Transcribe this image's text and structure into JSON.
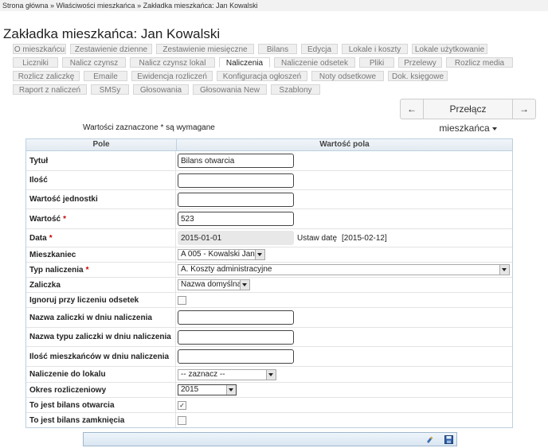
{
  "breadcrumb": "Strona główna » Właściwości mieszkańca » Zakładka mieszkańca: Jan Kowalski",
  "page_title": "Zakładka mieszkańca: Jan Kowalski",
  "tabs": {
    "row1": [
      "O mieszkańcu",
      "Zestawienie dzienne",
      "Zestawienie miesięczne",
      "Bilans",
      "Edycja",
      "Lokale i koszty",
      "Lokale użytkowanie"
    ],
    "row2": [
      "Liczniki",
      "Nalicz czynsz",
      "Nalicz czynsz lokal",
      "Naliczenia",
      "Naliczenie odsetek",
      "Pliki",
      "Przelewy",
      "Rozlicz media"
    ],
    "row3": [
      "Rozlicz zaliczkę",
      "Emaile",
      "Ewidencja rozliczeń",
      "Konfiguracja ogłoszeń",
      "Noty odsetkowe",
      "Dok. księgowe"
    ],
    "row4": [
      "Raport z naliczeń",
      "SMSy",
      "Głosowania",
      "Głosowania New",
      "Szablony"
    ],
    "active": "Naliczenia"
  },
  "nav": {
    "prev": "←",
    "switch": "Przełącz mieszkańca",
    "next": "→"
  },
  "required_note": "Wartości zaznaczone * są wymagane",
  "table": {
    "col_field": "Pole",
    "col_value": "Wartość pola",
    "rows": {
      "tytul": {
        "label": "Tytuł",
        "value": "Bilans otwarcia"
      },
      "ilosc": {
        "label": "Ilość",
        "value": ""
      },
      "wartosc_jedn": {
        "label": "Wartość jednostki",
        "value": ""
      },
      "wartosc": {
        "label": "Wartość",
        "value": "523",
        "required": "*"
      },
      "data": {
        "label": "Data",
        "value": "2015-01-01",
        "required": "*",
        "set_date": "Ustaw datę",
        "date_hint": "[2015-02-12]"
      },
      "mieszkaniec": {
        "label": "Mieszkaniec",
        "value": "A 005 - Kowalski Jan"
      },
      "typ": {
        "label": "Typ naliczenia",
        "value": "A. Koszty administracyjne",
        "required": "*"
      },
      "zaliczka": {
        "label": "Zaliczka",
        "value": "Nazwa domyślna"
      },
      "ignoruj": {
        "label": "Ignoruj przy liczeniu odsetek",
        "checked": false
      },
      "nazwa_zal": {
        "label": "Nazwa zaliczki w dniu naliczenia",
        "value": ""
      },
      "nazwa_typu": {
        "label": "Nazwa typu zaliczki w dniu naliczenia",
        "value": ""
      },
      "ilosc_mieszk": {
        "label": "Ilość mieszkańców w dniu naliczenia",
        "value": ""
      },
      "do_lokalu": {
        "label": "Naliczenie do lokalu",
        "value": "-- zaznacz --"
      },
      "okres": {
        "label": "Okres rozliczeniowy",
        "value": "2015"
      },
      "bilans_otw": {
        "label": "To jest bilans otwarcia",
        "checked": true,
        "mark": "✓"
      },
      "bilans_zam": {
        "label": "To jest bilans zamknięcia",
        "checked": false
      }
    }
  },
  "colors": {
    "header_border": "#bcd0e0",
    "required": "#cc0000"
  }
}
